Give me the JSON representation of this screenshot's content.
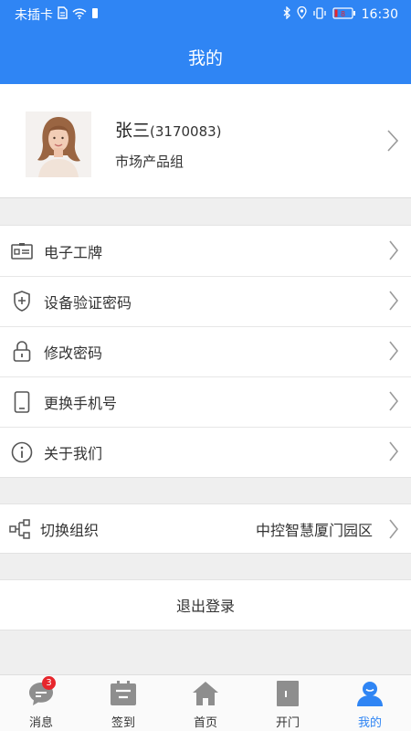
{
  "status_bar": {
    "carrier": "未插卡",
    "battery_level": "8",
    "time": "16:30"
  },
  "header": {
    "title": "我的"
  },
  "profile": {
    "name": "张三",
    "id": "(3170083)",
    "department": "市场产品组"
  },
  "menu": {
    "items": [
      {
        "label": "电子工牌",
        "icon": "badge-card-icon"
      },
      {
        "label": "设备验证密码",
        "icon": "shield-plus-icon"
      },
      {
        "label": "修改密码",
        "icon": "lock-icon"
      },
      {
        "label": "更换手机号",
        "icon": "tablet-icon"
      },
      {
        "label": "关于我们",
        "icon": "info-icon"
      }
    ]
  },
  "organization": {
    "label": "切换组织",
    "value": "中控智慧厦门园区",
    "icon": "org-tree-icon"
  },
  "logout": {
    "label": "退出登录"
  },
  "tab_bar": {
    "tabs": [
      {
        "label": "消息",
        "icon": "message-icon",
        "badge": "3"
      },
      {
        "label": "签到",
        "icon": "calendar-icon"
      },
      {
        "label": "首页",
        "icon": "home-icon"
      },
      {
        "label": "开门",
        "icon": "door-icon"
      },
      {
        "label": "我的",
        "icon": "user-icon",
        "active": true
      }
    ]
  },
  "colors": {
    "primary": "#2f85f4",
    "inactive_icon": "#8e8e8e",
    "badge": "#e7262c"
  }
}
